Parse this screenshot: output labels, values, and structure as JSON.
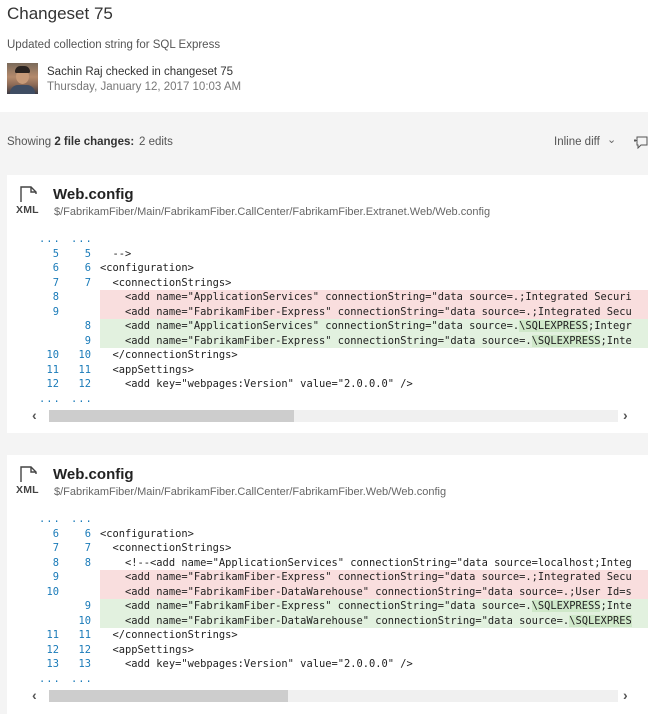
{
  "header": {
    "title": "Changeset 75",
    "description": "Updated collection string for SQL Express",
    "author_line": "Sachin Raj checked in changeset 75",
    "date": "Thursday, January 12, 2017 10:03 AM"
  },
  "toolbar": {
    "showing_prefix": "Showing ",
    "showing_count": "2 file changes:",
    "edits": "2 edits",
    "view_mode": "Inline diff",
    "chevron": "⌄"
  },
  "files": [
    {
      "icon_label": "XML",
      "name": "Web.config",
      "path": "$/FabrikamFiber/Main/FabrikamFiber.CallCenter/FabrikamFiber.Extranet.Web/Web.config",
      "rows": [
        {
          "type": "ellipsis",
          "l1": "...",
          "l2": "...",
          "pre": "",
          "hl": "",
          "post": ""
        },
        {
          "type": "ctx",
          "l1": "5",
          "l2": "5",
          "pre": "  -->",
          "hl": "",
          "post": ""
        },
        {
          "type": "ctx",
          "l1": "6",
          "l2": "6",
          "pre": "<configuration>",
          "hl": "",
          "post": ""
        },
        {
          "type": "ctx",
          "l1": "7",
          "l2": "7",
          "pre": "  <connectionStrings>",
          "hl": "",
          "post": ""
        },
        {
          "type": "del",
          "l1": "8",
          "l2": "",
          "pre": "    <add name=\"ApplicationServices\" connectionString=\"data source=.;Integrated Securi",
          "hl": "",
          "post": ""
        },
        {
          "type": "del",
          "l1": "9",
          "l2": "",
          "pre": "    <add name=\"FabrikamFiber-Express\" connectionString=\"data source=.;Integrated Secu",
          "hl": "",
          "post": ""
        },
        {
          "type": "add",
          "l1": "",
          "l2": "8",
          "pre": "    <add name=\"ApplicationServices\" connectionString=\"data source=.",
          "hl": "\\SQLEXPRESS",
          "post": ";Integr"
        },
        {
          "type": "add",
          "l1": "",
          "l2": "9",
          "pre": "    <add name=\"FabrikamFiber-Express\" connectionString=\"data source=.",
          "hl": "\\SQLEXPRESS",
          "post": ";Inte"
        },
        {
          "type": "ctx",
          "l1": "10",
          "l2": "10",
          "pre": "  </connectionStrings>",
          "hl": "",
          "post": ""
        },
        {
          "type": "ctx",
          "l1": "11",
          "l2": "11",
          "pre": "  <appSettings>",
          "hl": "",
          "post": ""
        },
        {
          "type": "ctx",
          "l1": "12",
          "l2": "12",
          "pre": "    <add key=\"webpages:Version\" value=\"2.0.0.0\" />",
          "hl": "",
          "post": ""
        },
        {
          "type": "ellipsis",
          "l1": "...",
          "l2": "...",
          "pre": "",
          "hl": "",
          "post": ""
        }
      ],
      "scroll": {
        "left_arrow": "‹",
        "right_arrow": "›",
        "position": 0.0,
        "visible_fraction": 0.43
      }
    },
    {
      "icon_label": "XML",
      "name": "Web.config",
      "path": "$/FabrikamFiber/Main/FabrikamFiber.CallCenter/FabrikamFiber.Web/Web.config",
      "rows": [
        {
          "type": "ellipsis",
          "l1": "...",
          "l2": "...",
          "pre": "",
          "hl": "",
          "post": ""
        },
        {
          "type": "ctx",
          "l1": "6",
          "l2": "6",
          "pre": "<configuration>",
          "hl": "",
          "post": ""
        },
        {
          "type": "ctx",
          "l1": "7",
          "l2": "7",
          "pre": "  <connectionStrings>",
          "hl": "",
          "post": ""
        },
        {
          "type": "ctx",
          "l1": "8",
          "l2": "8",
          "pre": "    <!--<add name=\"ApplicationServices\" connectionString=\"data source=localhost;Integ",
          "hl": "",
          "post": ""
        },
        {
          "type": "del",
          "l1": "9",
          "l2": "",
          "pre": "    <add name=\"FabrikamFiber-Express\" connectionString=\"data source=.;Integrated Secu",
          "hl": "",
          "post": ""
        },
        {
          "type": "del",
          "l1": "10",
          "l2": "",
          "pre": "    <add name=\"FabrikamFiber-DataWarehouse\" connectionString=\"data source=.;User Id=s",
          "hl": "",
          "post": ""
        },
        {
          "type": "add",
          "l1": "",
          "l2": "9",
          "pre": "    <add name=\"FabrikamFiber-Express\" connectionString=\"data source=.",
          "hl": "\\SQLEXPRESS",
          "post": ";Inte"
        },
        {
          "type": "add",
          "l1": "",
          "l2": "10",
          "pre": "    <add name=\"FabrikamFiber-DataWarehouse\" connectionString=\"data source=.",
          "hl": "\\SQLEXPRES",
          "post": ""
        },
        {
          "type": "ctx",
          "l1": "11",
          "l2": "11",
          "pre": "  </connectionStrings>",
          "hl": "",
          "post": ""
        },
        {
          "type": "ctx",
          "l1": "12",
          "l2": "12",
          "pre": "  <appSettings>",
          "hl": "",
          "post": ""
        },
        {
          "type": "ctx",
          "l1": "13",
          "l2": "13",
          "pre": "    <add key=\"webpages:Version\" value=\"2.0.0.0\" />",
          "hl": "",
          "post": ""
        },
        {
          "type": "ellipsis",
          "l1": "...",
          "l2": "...",
          "pre": "",
          "hl": "",
          "post": ""
        }
      ],
      "scroll": {
        "left_arrow": "‹",
        "right_arrow": "›",
        "position": 0.0,
        "visible_fraction": 0.42
      }
    }
  ]
}
